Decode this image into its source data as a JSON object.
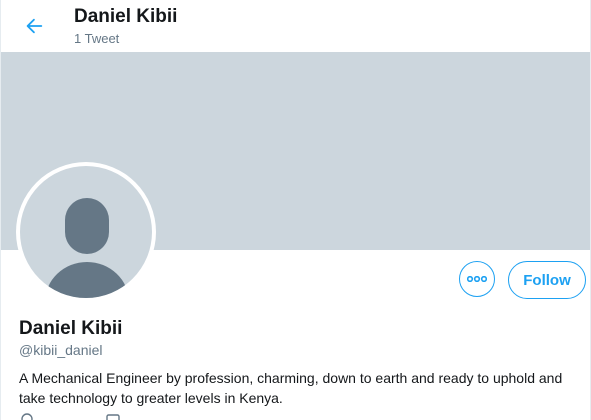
{
  "header": {
    "name": "Daniel Kibii",
    "tweet_count": "1 Tweet",
    "back_icon": "arrow-left-icon"
  },
  "profile": {
    "name": "Daniel Kibii",
    "handle": "@kibii_daniel",
    "bio": "A Mechanical Engineer by profession, charming, down to earth and ready to uphold and take technology to greater levels in Kenya.",
    "follow_label": "Follow",
    "more_icon": "more-icon"
  },
  "colors": {
    "accent": "#1da1f2",
    "banner": "#ccd6dd",
    "avatar_silhouette": "#657786",
    "secondary_text": "#657786"
  }
}
